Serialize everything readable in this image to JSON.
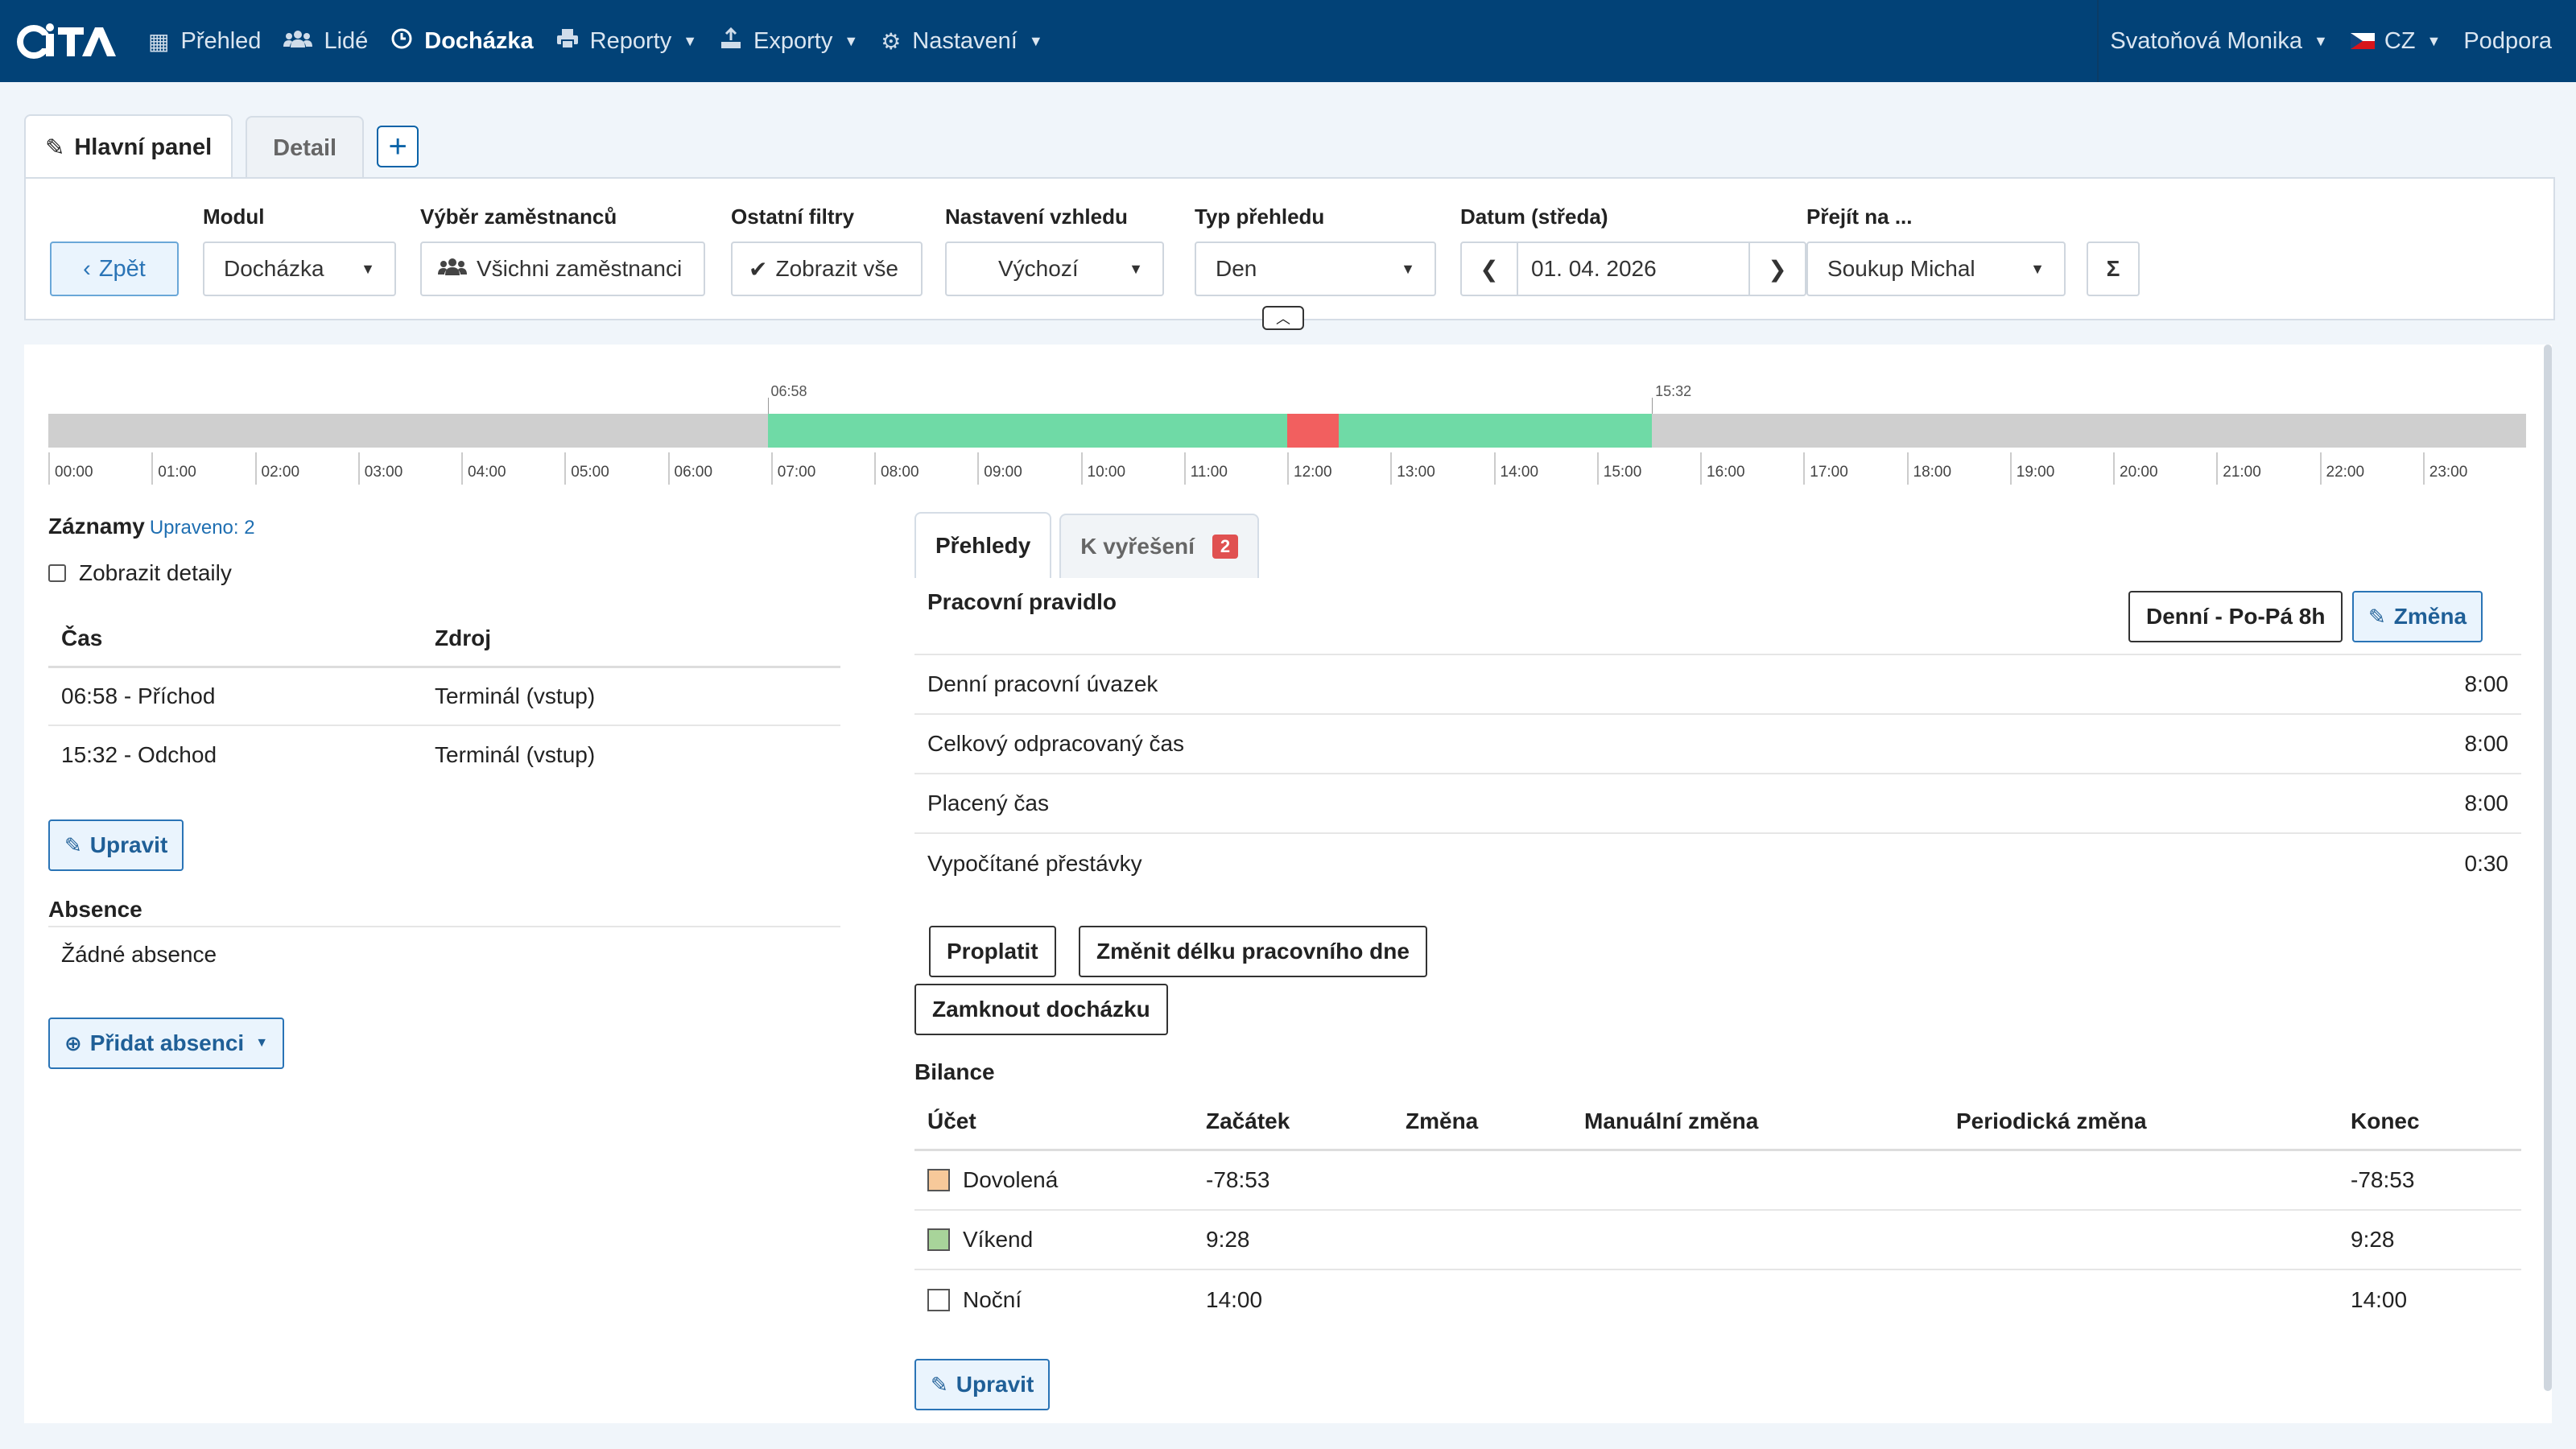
{
  "navbar": {
    "logo": "iTA",
    "items": [
      {
        "icon": "grid-icon",
        "label": "Přehled"
      },
      {
        "icon": "users-icon",
        "label": "Lidé"
      },
      {
        "icon": "clock-icon",
        "label": "Docházka"
      },
      {
        "icon": "print-icon",
        "label": "Reporty"
      },
      {
        "icon": "export-icon",
        "label": "Exporty"
      },
      {
        "icon": "gear-icon",
        "label": "Nastavení"
      }
    ],
    "user": "Svatoňová Monika",
    "language": "CZ",
    "support": "Podpora"
  },
  "panel_tabs": {
    "main": "Hlavní panel",
    "detail": "Detail",
    "add": "+"
  },
  "filters": {
    "back": "Zpět",
    "modul_label": "Modul",
    "modul_value": "Docházka",
    "employees_label": "Výběr zaměstnanců",
    "employees_value": "Všichni zaměstnanci",
    "other_label": "Ostatní filtry",
    "other_value": "Zobrazit vše",
    "view_label": "Nastavení vzhledu",
    "view_value": "Výchozí",
    "type_label": "Typ přehledu",
    "type_value": "Den",
    "date_label": "Datum (středa)",
    "date_value": "01. 04. 2026",
    "goto_label": "Přejít na ...",
    "goto_value": "Soukup Michal",
    "sum_symbol": "Σ"
  },
  "timeline": {
    "start_marker": "06:58",
    "end_marker": "15:32",
    "ticks": [
      "00:00",
      "01:00",
      "02:00",
      "03:00",
      "04:00",
      "05:00",
      "06:00",
      "07:00",
      "08:00",
      "09:00",
      "10:00",
      "11:00",
      "12:00",
      "13:00",
      "14:00",
      "15:00",
      "16:00",
      "17:00",
      "18:00",
      "19:00",
      "20:00",
      "21:00",
      "22:00",
      "23:00"
    ],
    "work_start_hours": 6.967,
    "work_end_hours": 15.533,
    "break_start_hours": 12.0,
    "break_end_hours": 12.5,
    "colors": {
      "work": "#6fdaa6",
      "break": "#f25f5f",
      "idle": "#cfcfcf"
    }
  },
  "records": {
    "title": "Záznamy",
    "edited": "Upraveno: 2",
    "show_details": "Zobrazit detaily",
    "col_time": "Čas",
    "col_source": "Zdroj",
    "rows": [
      {
        "time": "06:58 - Příchod",
        "source": "Terminál (vstup)"
      },
      {
        "time": "15:32 - Odchod",
        "source": "Terminál (vstup)"
      }
    ],
    "edit_button": "Upravit"
  },
  "absence": {
    "title": "Absence",
    "empty": "Žádné absence",
    "add_button": "Přidat absenci"
  },
  "overview_tabs": {
    "overview": "Přehledy",
    "to_resolve": "K vyřešení",
    "to_resolve_count": "2"
  },
  "overview": {
    "rule_label": "Pracovní pravidlo",
    "rule_value": "Denní - Po-Pá 8h",
    "change_button": "Změna",
    "rows": [
      {
        "label": "Denní pracovní úvazek",
        "value": "8:00"
      },
      {
        "label": "Celkový odpracovaný čas",
        "value": "8:00"
      },
      {
        "label": "Placený čas",
        "value": "8:00"
      },
      {
        "label": "Vypočítané přestávky",
        "value": "0:30"
      }
    ],
    "pay_button": "Proplatit",
    "change_length_button": "Změnit délku pracovního dne",
    "lock_button": "Zamknout docházku"
  },
  "balance": {
    "title": "Bilance",
    "headers": [
      "Účet",
      "Začátek",
      "Změna",
      "Manuální změna",
      "Periodická změna",
      "Konec"
    ],
    "rows": [
      {
        "account": "Dovolená",
        "color": "#f7c99a",
        "start": "-78:53",
        "change": "",
        "manual": "",
        "periodic": "",
        "end": "-78:53"
      },
      {
        "account": "Víkend",
        "color": "#a8d49a",
        "start": "9:28",
        "change": "",
        "manual": "",
        "periodic": "",
        "end": "9:28"
      },
      {
        "account": "Noční",
        "color": "#ffffff",
        "start": "14:00",
        "change": "",
        "manual": "",
        "periodic": "",
        "end": "14:00"
      }
    ],
    "edit_button": "Upravit"
  }
}
